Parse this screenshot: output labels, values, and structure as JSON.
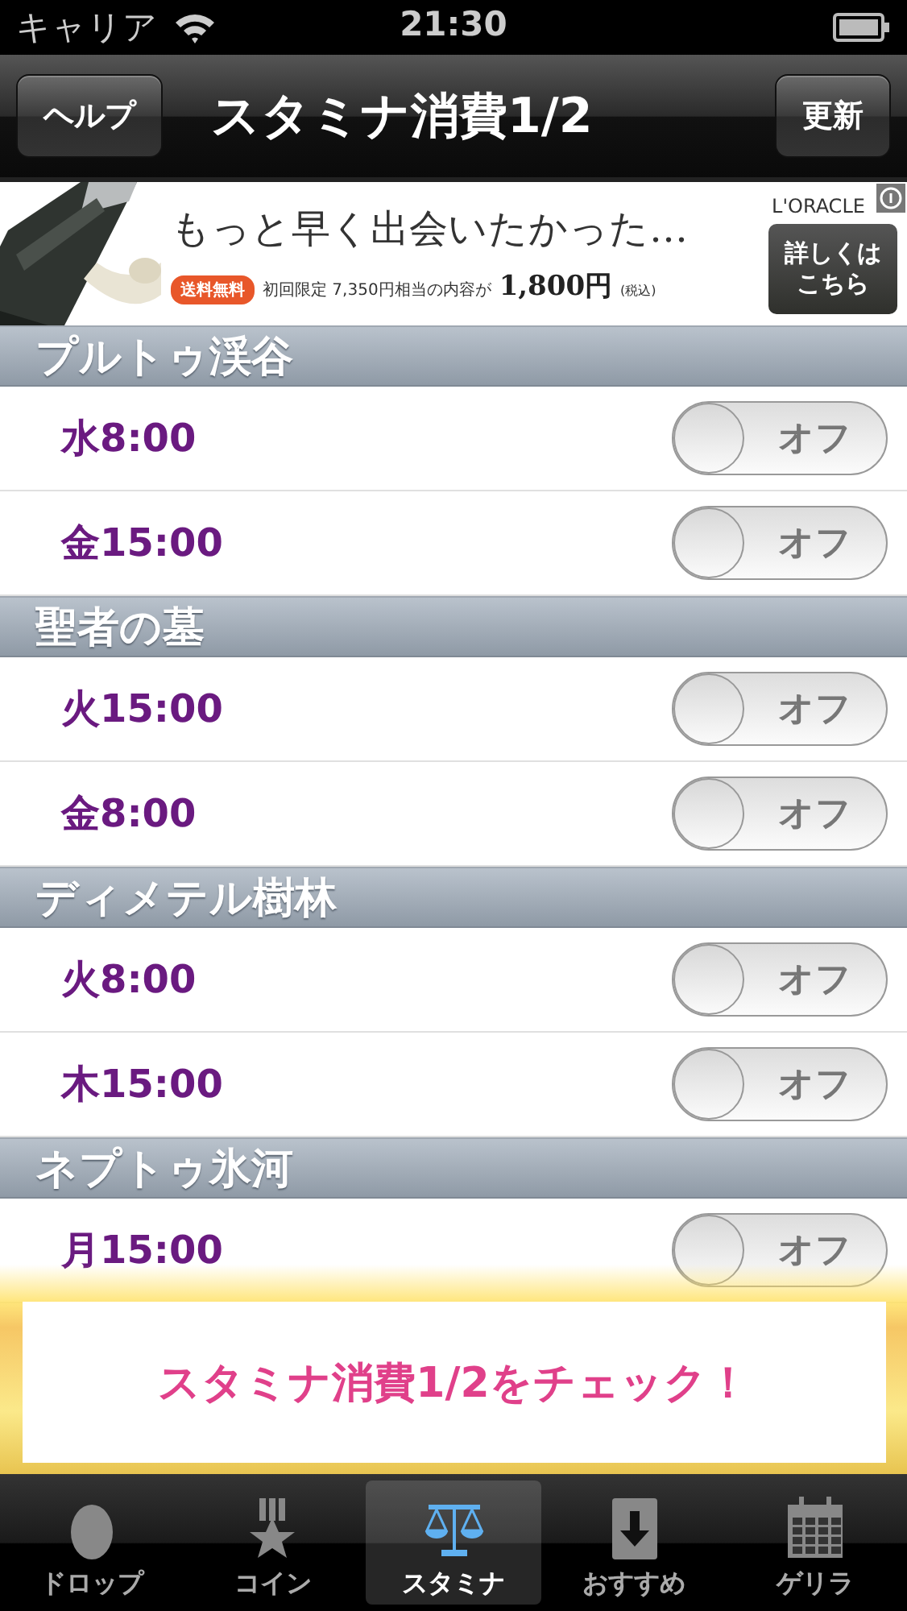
{
  "status_bar": {
    "carrier": "キャリア",
    "time": "21:30"
  },
  "nav_bar": {
    "left_button": "ヘルプ",
    "title": "スタミナ消費1/2",
    "right_button": "更新"
  },
  "ad": {
    "headline": "もっと早く出会いたかった…",
    "brand": "L'ORACLE",
    "badge": "送料無料",
    "offer": "初回限定 7,350円相当の内容が",
    "price": "1,800円",
    "tax": "(税込)",
    "button": "詳しくはこちら"
  },
  "sections": [
    {
      "title": "プルトゥ渓谷",
      "rows": [
        {
          "time": "水8:00",
          "switch": "オフ",
          "on": false
        },
        {
          "time": "金15:00",
          "switch": "オフ",
          "on": false
        }
      ]
    },
    {
      "title": "聖者の墓",
      "rows": [
        {
          "time": "火15:00",
          "switch": "オフ",
          "on": false
        },
        {
          "time": "金8:00",
          "switch": "オフ",
          "on": false
        }
      ]
    },
    {
      "title": "ディメテル樹林",
      "rows": [
        {
          "time": "火8:00",
          "switch": "オフ",
          "on": false
        },
        {
          "time": "木15:00",
          "switch": "オフ",
          "on": false
        }
      ]
    },
    {
      "title": "ネプトゥ氷河",
      "rows": [
        {
          "time": "月15:00",
          "switch": "オフ",
          "on": false
        }
      ]
    }
  ],
  "popup": {
    "text": "スタミナ消費1/2をチェック！"
  },
  "tabs": [
    {
      "label": "ドロップ",
      "kind": "egg",
      "selected": false
    },
    {
      "label": "コイン",
      "kind": "medal",
      "selected": false
    },
    {
      "label": "スタミナ",
      "kind": "scale",
      "selected": true
    },
    {
      "label": "おすすめ",
      "kind": "download",
      "selected": false
    },
    {
      "label": "ゲリラ",
      "kind": "calendar",
      "selected": false
    }
  ]
}
